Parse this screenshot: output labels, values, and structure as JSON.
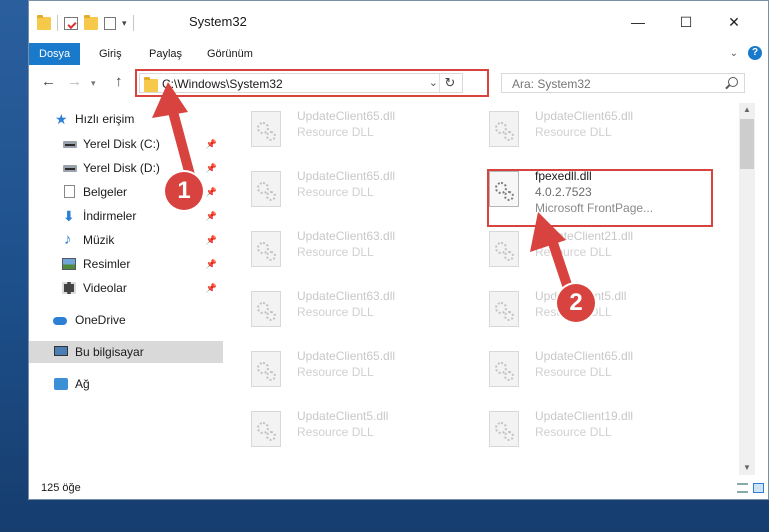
{
  "window": {
    "title": "System32"
  },
  "ribbon": {
    "tabs": [
      "Dosya",
      "Giriş",
      "Paylaş",
      "Görünüm"
    ]
  },
  "address": {
    "path": "C:\\Windows\\System32"
  },
  "search": {
    "placeholder": "Ara: System32"
  },
  "sidebar": {
    "items": [
      {
        "label": "Hızlı erişim",
        "icon": "star-icon"
      },
      {
        "label": "Yerel Disk (C:)",
        "icon": "drive-icon",
        "pinned": true
      },
      {
        "label": "Yerel Disk (D:)",
        "icon": "drive-icon",
        "pinned": true
      },
      {
        "label": "Belgeler",
        "icon": "document-icon",
        "pinned": true
      },
      {
        "label": "İndirmeler",
        "icon": "download-icon",
        "pinned": true
      },
      {
        "label": "Müzik",
        "icon": "music-icon",
        "pinned": true
      },
      {
        "label": "Resimler",
        "icon": "pictures-icon",
        "pinned": true
      },
      {
        "label": "Videolar",
        "icon": "video-icon",
        "pinned": true
      },
      {
        "label": "OneDrive",
        "icon": "cloud-icon"
      },
      {
        "label": "Bu bilgisayar",
        "icon": "computer-icon",
        "selected": true
      },
      {
        "label": "Ağ",
        "icon": "network-icon"
      }
    ]
  },
  "files": [
    {
      "name": "UpdateClient65.dll",
      "desc": "Resource DLL"
    },
    {
      "name": "UpdateClient65.dll",
      "desc": "Resource DLL"
    },
    {
      "name": "UpdateClient65.dll",
      "desc": "Resource DLL"
    },
    {
      "name": "fpexedll.dll",
      "desc": "4.0.2.7523",
      "desc2": "Microsoft FrontPage...",
      "highlighted": true
    },
    {
      "name": "UpdateClient63.dll",
      "desc": "Resource DLL"
    },
    {
      "name": "UpdateClient21.dll",
      "desc": "Resource DLL"
    },
    {
      "name": "UpdateClient63.dll",
      "desc": "Resource DLL"
    },
    {
      "name": "UpdateClient5.dll",
      "desc": "Resource DLL"
    },
    {
      "name": "UpdateClient65.dll",
      "desc": "Resource DLL"
    },
    {
      "name": "UpdateClient65.dll",
      "desc": "Resource DLL"
    },
    {
      "name": "UpdateClient5.dll",
      "desc": "Resource DLL"
    },
    {
      "name": "UpdateClient19.dll",
      "desc": "Resource DLL"
    }
  ],
  "status": {
    "count": "125 öğe"
  },
  "annotations": {
    "step1": "1",
    "step2": "2",
    "color": "#d9433f"
  }
}
